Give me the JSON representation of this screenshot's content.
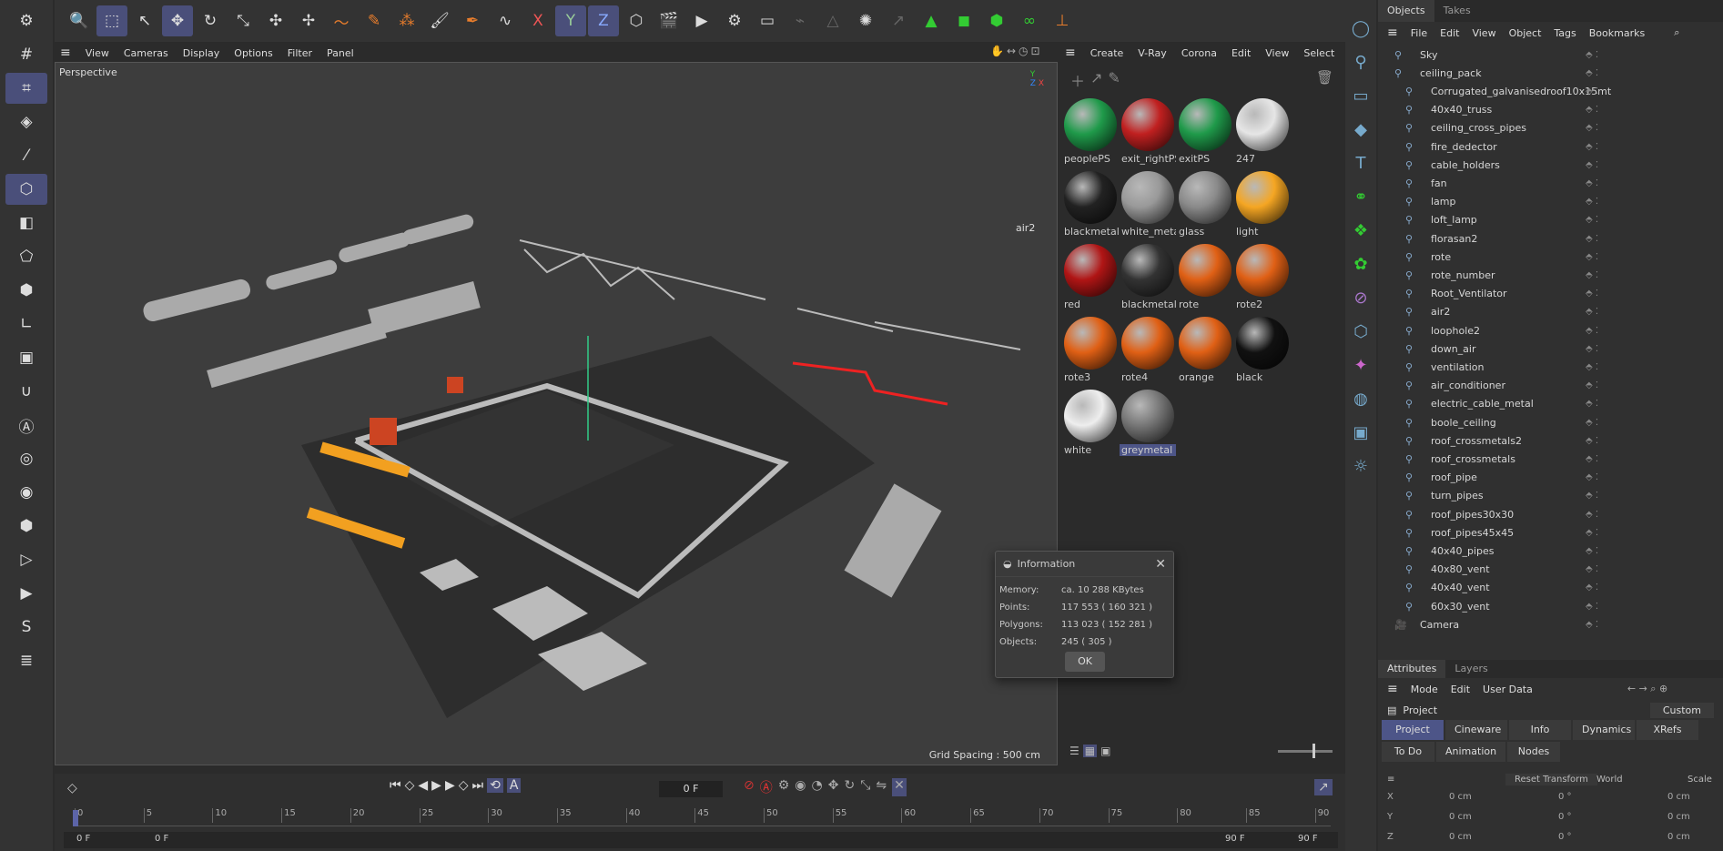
{
  "toolbar": {
    "icons": [
      "search-icon",
      "select-icon",
      "live-select-icon",
      "move-icon",
      "rotate-icon",
      "scale-icon",
      "snap-icon",
      "transform-icon",
      "spline-pen-icon",
      "spline-icon",
      "spline-more-icon",
      "brush-icon",
      "pen-icon",
      "sketch-icon",
      "x-axis-icon",
      "y-axis-icon",
      "z-axis-icon",
      "coordinate-icon",
      "clapper-icon",
      "render-view-icon",
      "render-settings-icon",
      "render-queue-icon",
      "link-icon",
      "warning-icon",
      "spark-icon",
      "arrow-icon",
      "pyramid-icon",
      "cube-icon",
      "green-cube-icon",
      "green-shape-icon",
      "gimbal-icon"
    ]
  },
  "viewport": {
    "menu": [
      "View",
      "Cameras",
      "Display",
      "Options",
      "Filter",
      "Panel"
    ],
    "title": "Perspective",
    "grid": "Grid Spacing : 500 cm",
    "object_label": "air2"
  },
  "materials": {
    "menu": [
      "Create",
      "V-Ray",
      "Corona",
      "Edit",
      "View",
      "Select"
    ],
    "items": [
      {
        "name": "peoplePS",
        "color": "#1f9a4a"
      },
      {
        "name": "exit_rightPS",
        "color": "#c02020"
      },
      {
        "name": "exitPS",
        "color": "#1f9a4a"
      },
      {
        "name": "247",
        "color": "#e6e6e6"
      },
      {
        "name": "blackmetalF",
        "color": "#222"
      },
      {
        "name": "white_meta",
        "color": "#999"
      },
      {
        "name": "glass",
        "color": "#8a8a8a"
      },
      {
        "name": "light",
        "color": "#f5a623"
      },
      {
        "name": "red",
        "color": "#b01515"
      },
      {
        "name": "blackmetal",
        "color": "#333"
      },
      {
        "name": "rote",
        "color": "#e06015"
      },
      {
        "name": "rote2",
        "color": "#e06015"
      },
      {
        "name": "rote3",
        "color": "#e06015"
      },
      {
        "name": "rote4",
        "color": "#e06015"
      },
      {
        "name": "orange",
        "color": "#e06015"
      },
      {
        "name": "black",
        "color": "#111"
      },
      {
        "name": "white",
        "color": "#eee"
      },
      {
        "name": "greymetal",
        "color": "#777"
      }
    ]
  },
  "objects": {
    "tabs": [
      "Objects",
      "Takes"
    ],
    "menu": [
      "File",
      "Edit",
      "View",
      "Object",
      "Tags",
      "Bookmarks"
    ],
    "rows": [
      "Sky",
      "ceiling_pack",
      "Corrugated_galvanisedroof10x15mt",
      "40x40_truss",
      "ceiling_cross_pipes",
      "fire_dedector",
      "cable_holders",
      "fan",
      "lamp",
      "loft_lamp",
      "florasan2",
      "rote",
      "rote_number",
      "Root_Ventilator",
      "air2",
      "loophole2",
      "down_air",
      "ventilation",
      "air_conditioner",
      "electric_cable_metal",
      "boole_ceiling",
      "roof_crossmetals2",
      "roof_crossmetals",
      "roof_pipe",
      "turn_pipes",
      "roof_pipes30x30",
      "roof_pipes45x45",
      "40x40_pipes",
      "40x80_vent",
      "40x40_vent",
      "60x30_vent",
      "Camera"
    ]
  },
  "attributes": {
    "tabs": [
      "Attributes",
      "Layers"
    ],
    "menu": [
      "Mode",
      "Edit",
      "User Data"
    ],
    "project": "Project",
    "custom": "Custom",
    "tabs2": [
      "Project",
      "Cineware",
      "Info",
      "Dynamics",
      "XRefs",
      "To Do",
      "Animation",
      "Nodes"
    ],
    "reset": "Reset Transform",
    "world": "World",
    "scale": "Scale",
    "coords": [
      {
        "axis": "X",
        "v1": "0 cm",
        "v2": "0 °",
        "v3": "0 cm"
      },
      {
        "axis": "Y",
        "v1": "0 cm",
        "v2": "0 °",
        "v3": "0 cm"
      },
      {
        "axis": "Z",
        "v1": "0 cm",
        "v2": "0 °",
        "v3": "0 cm"
      }
    ]
  },
  "info_dialog": {
    "title": "Information",
    "rows": [
      {
        "k": "Memory:",
        "v": "ca. 10 288 KBytes"
      },
      {
        "k": "Points:",
        "v": "117 553 ( 160 321 )"
      },
      {
        "k": "Polygons:",
        "v": "113 023 ( 152 281 )"
      },
      {
        "k": "Objects:",
        "v": "245 ( 305 )"
      }
    ],
    "ok": "OK"
  },
  "timeline": {
    "frame": "0 F",
    "start": "0 F",
    "start2": "0 F",
    "end": "90 F",
    "end2": "90 F",
    "ticks": [
      "0",
      "5",
      "10",
      "15",
      "20",
      "25",
      "30",
      "35",
      "40",
      "45",
      "50",
      "55",
      "60",
      "65",
      "70",
      "75",
      "80",
      "85",
      "90"
    ]
  }
}
